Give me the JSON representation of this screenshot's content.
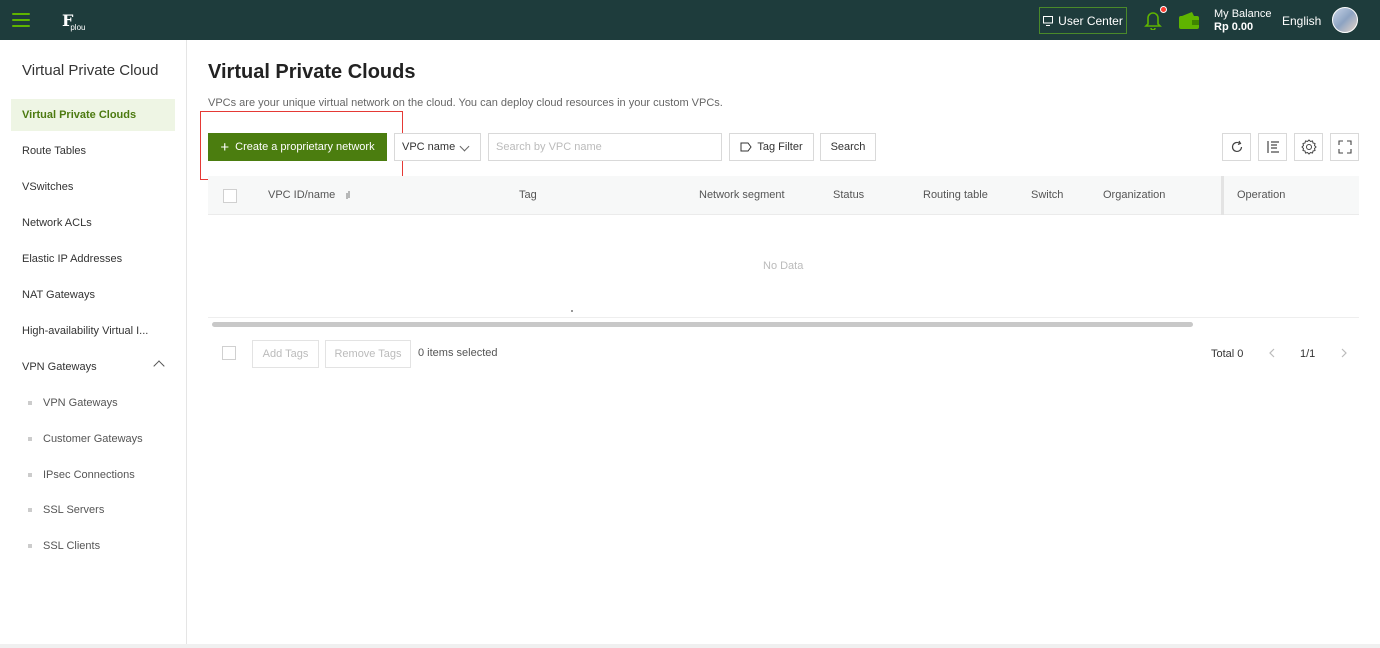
{
  "topbar": {
    "logo_text": "F",
    "logo_sub": "plou",
    "user_center": "User Center",
    "balance_label": "My Balance",
    "balance_amount": "Rp 0.00",
    "language": "English"
  },
  "sidebar": {
    "title": "Virtual Private Cloud",
    "items": [
      {
        "label": "Virtual Private Clouds"
      },
      {
        "label": "Route Tables"
      },
      {
        "label": "VSwitches"
      },
      {
        "label": "Network ACLs"
      },
      {
        "label": "Elastic IP Addresses"
      },
      {
        "label": "NAT Gateways"
      },
      {
        "label": "High-availability Virtual I..."
      },
      {
        "label": "VPN Gateways"
      }
    ],
    "sub_items": [
      {
        "label": "VPN Gateways"
      },
      {
        "label": "Customer Gateways"
      },
      {
        "label": "IPsec Connections"
      },
      {
        "label": "SSL Servers"
      },
      {
        "label": "SSL Clients"
      }
    ]
  },
  "main": {
    "title": "Virtual Private Clouds",
    "description": "VPCs are your unique virtual network on the cloud. You can deploy cloud resources in your custom VPCs.",
    "create_button": "Create a proprietary network",
    "filter_select": "VPC name",
    "search_placeholder": "Search by VPC name",
    "tag_filter": "Tag Filter",
    "search_button": "Search"
  },
  "table": {
    "columns": [
      "VPC ID/name",
      "Tag",
      "Network segment",
      "Status",
      "Routing table",
      "Switch",
      "Organization",
      "Operation"
    ],
    "empty_text": "No Data"
  },
  "footer": {
    "add_tags": "Add Tags",
    "remove_tags": "Remove Tags",
    "selected": "0 items selected",
    "total": "Total 0",
    "page": "1/1"
  },
  "colors": {
    "topbar_bg": "#1e3c3c",
    "accent": "#4b7d0f",
    "highlight": "#e53935"
  }
}
